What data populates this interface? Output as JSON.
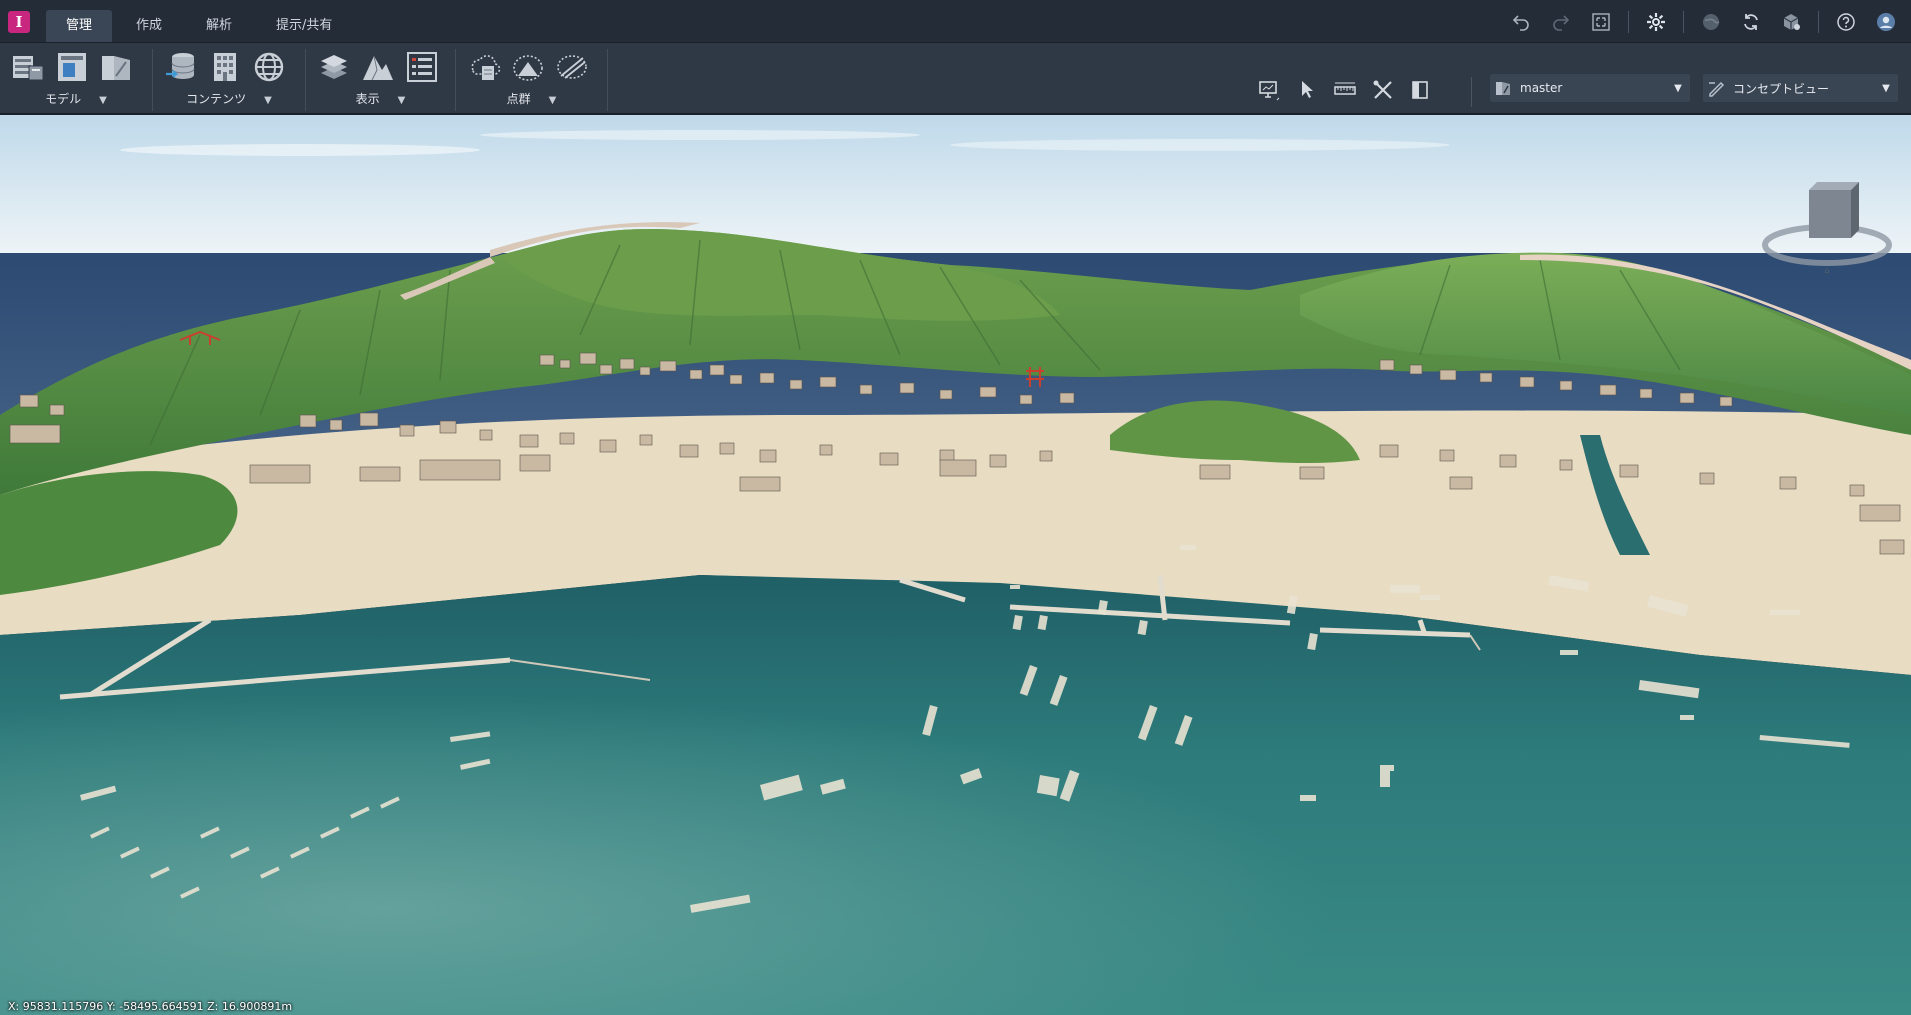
{
  "app": {
    "logo_letter": "I"
  },
  "tabs": [
    {
      "label": "管理",
      "active": true
    },
    {
      "label": "作成",
      "active": false
    },
    {
      "label": "解析",
      "active": false
    },
    {
      "label": "提示/共有",
      "active": false
    }
  ],
  "ribbon": {
    "groups": [
      {
        "label": "モデル",
        "icons": [
          "model-tree-icon",
          "model-panel-icon",
          "model-sheet-icon"
        ]
      },
      {
        "label": "コンテンツ",
        "icons": [
          "database-import-icon",
          "building-icon",
          "globe-icon"
        ]
      },
      {
        "label": "表示",
        "icons": [
          "layers-icon",
          "terrain-icon",
          "list-panel-icon"
        ]
      },
      {
        "label": "点群",
        "icons": [
          "pointcloud-icon",
          "pointcloud-terrain-icon",
          "pointcloud-slice-icon"
        ]
      }
    ],
    "tools": [
      "monitor-icon",
      "select-arrow-icon",
      "measure-ruler-icon",
      "tools-cross-icon",
      "section-box-icon"
    ]
  },
  "proposal_dropdown": {
    "value": "master"
  },
  "view_dropdown": {
    "value": "コンセプトビュー"
  },
  "status": {
    "coordinates": "X: 95831.115796 Y: -58495.664591 Z: 16.900891m"
  },
  "colors": {
    "brand": "#c8267f",
    "active_tab": "#3a4656",
    "ribbon_bg": "#2f3845",
    "sea": "#2a7273",
    "hills": "#5e9340"
  }
}
